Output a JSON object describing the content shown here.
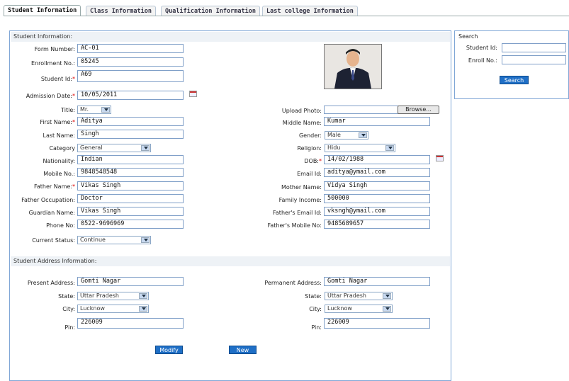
{
  "tabs": [
    "Student Information",
    "Class Information",
    "Qualification Information",
    "Last college Information"
  ],
  "student_panel_title": "Student Information:",
  "address_panel_title": "Student Address Information:",
  "left_fields": [
    {
      "label": "Form Number:",
      "value": "AC-01",
      "required": false
    },
    {
      "label": "Enrollment No.:",
      "value": "05245",
      "required": false
    },
    {
      "label": "Student Id:",
      "value": "A69",
      "required": true
    },
    {
      "label": "Admission Date:",
      "value": "10/05/2011",
      "required": true
    },
    {
      "label": "Title:",
      "value": "Mr.",
      "required": false
    },
    {
      "label": "First Name:",
      "value": "Aditya",
      "required": true
    },
    {
      "label": "Last Name:",
      "value": "Singh",
      "required": false
    },
    {
      "label": "Category",
      "value": "General",
      "required": false
    },
    {
      "label": "Nationality:",
      "value": "Indian",
      "required": false
    },
    {
      "label": "Mobile No.:",
      "value": "9848548548",
      "required": false
    },
    {
      "label": "Father Name:",
      "value": "Vikas Singh",
      "required": true
    },
    {
      "label": "Father Occupation:",
      "value": "Doctor",
      "required": false
    },
    {
      "label": "Guardian Name:",
      "value": "Vikas Singh",
      "required": false
    },
    {
      "label": "Phone No:",
      "value": "0522-9696969",
      "required": false
    },
    {
      "label": "Current Status:",
      "value": "Continue",
      "required": false
    }
  ],
  "right_fields": [
    {
      "label": "Upload Photo:",
      "value": "",
      "required": false
    },
    {
      "label": "Middle Name:",
      "value": "Kumar",
      "required": false
    },
    {
      "label": "Gender:",
      "value": "Male",
      "required": false
    },
    {
      "label": "Religion:",
      "value": "Hidu",
      "required": false
    },
    {
      "label": "DOB:",
      "value": "14/02/1988",
      "required": true
    },
    {
      "label": "Email Id:",
      "value": "aditya@ymail.com",
      "required": false
    },
    {
      "label": "Mother Name:",
      "value": "Vidya Singh",
      "required": false
    },
    {
      "label": "Family Income:",
      "value": "500000",
      "required": false
    },
    {
      "label": "Father's Email Id:",
      "value": "vksngh@ymail.com",
      "required": false
    },
    {
      "label": "Father's Mobile No:",
      "value": "9485689657",
      "required": false
    }
  ],
  "browse_label": "Browse...",
  "address_left": [
    {
      "label": "Present Address:",
      "value": "Gomti Nagar"
    },
    {
      "label": "State:",
      "value": "Uttar Pradesh"
    },
    {
      "label": "City:",
      "value": "Lucknow"
    },
    {
      "label": "Pin:",
      "value": "226009"
    }
  ],
  "address_right": [
    {
      "label": "Permanent Address:",
      "value": "Gomti Nagar"
    },
    {
      "label": "State:",
      "value": "Uttar Pradesh"
    },
    {
      "label": "City:",
      "value": "Lucknow"
    },
    {
      "label": "Pin:",
      "value": "226009"
    }
  ],
  "buttons": {
    "modify": "Modify",
    "new": "New"
  },
  "search": {
    "title": "Search",
    "student_id_label": "Student Id:",
    "enroll_label": "Enroll No.:",
    "button": "Search"
  },
  "colors": {
    "accent": "#1f6fc6",
    "panel_border": "#7fa6d6",
    "required": "#dd0000"
  }
}
